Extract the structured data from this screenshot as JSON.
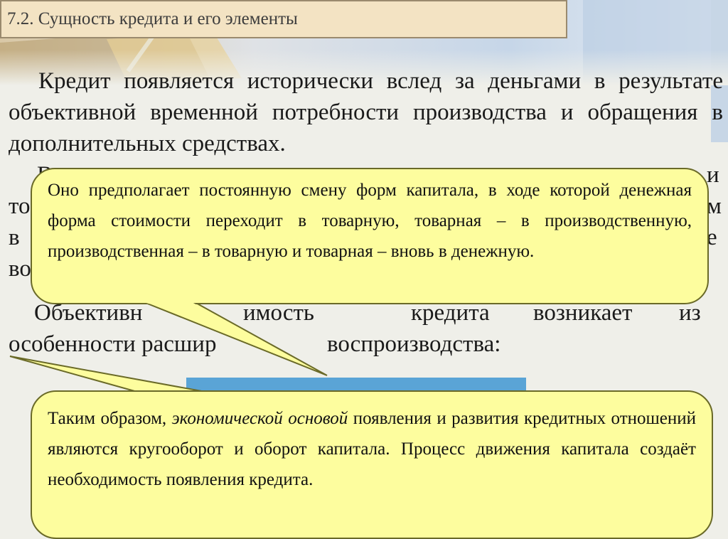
{
  "slide": {
    "title": "7.2. Сущность кредита и его элементы",
    "paragraph_1": "Кредит появляется исторически вслед за деньгами в результате объективной временной потребности производства и обращения в дополнительных средствах.",
    "partial_line_1": "В",
    "partial_line_2": "то",
    "partial_line_3": "в",
    "partial_line_4": "во",
    "partial_right_1": "и",
    "partial_right_2": "м",
    "partial_right_3": "е",
    "paragraph_3_line_1_fragments": [
      "Объективн",
      "имость",
      "кредита",
      "возникает",
      "из"
    ],
    "paragraph_3_line_2_fragments": [
      "особенности расшир",
      "воспроизводства:"
    ]
  },
  "callouts": [
    {
      "text": "Оно предполагает постоянную смену форм капитала, в ходе которой денежная форма стоимости переходит в товарную, товарная – в производственную, производственная – в товарную и товарная – вновь в денежную."
    },
    {
      "text_before": "Таким образом,",
      "italic": "экономической основой",
      "text_after": "появления и развития кредитных отношений являются кругооборот и оборот капитала. Процесс движения капитала создаёт необходимость появления кредита."
    }
  ],
  "colors": {
    "callout_fill": "#fdfd9e",
    "title_fill": "#f3e3c3",
    "blue_box": "#5aa4d6"
  }
}
